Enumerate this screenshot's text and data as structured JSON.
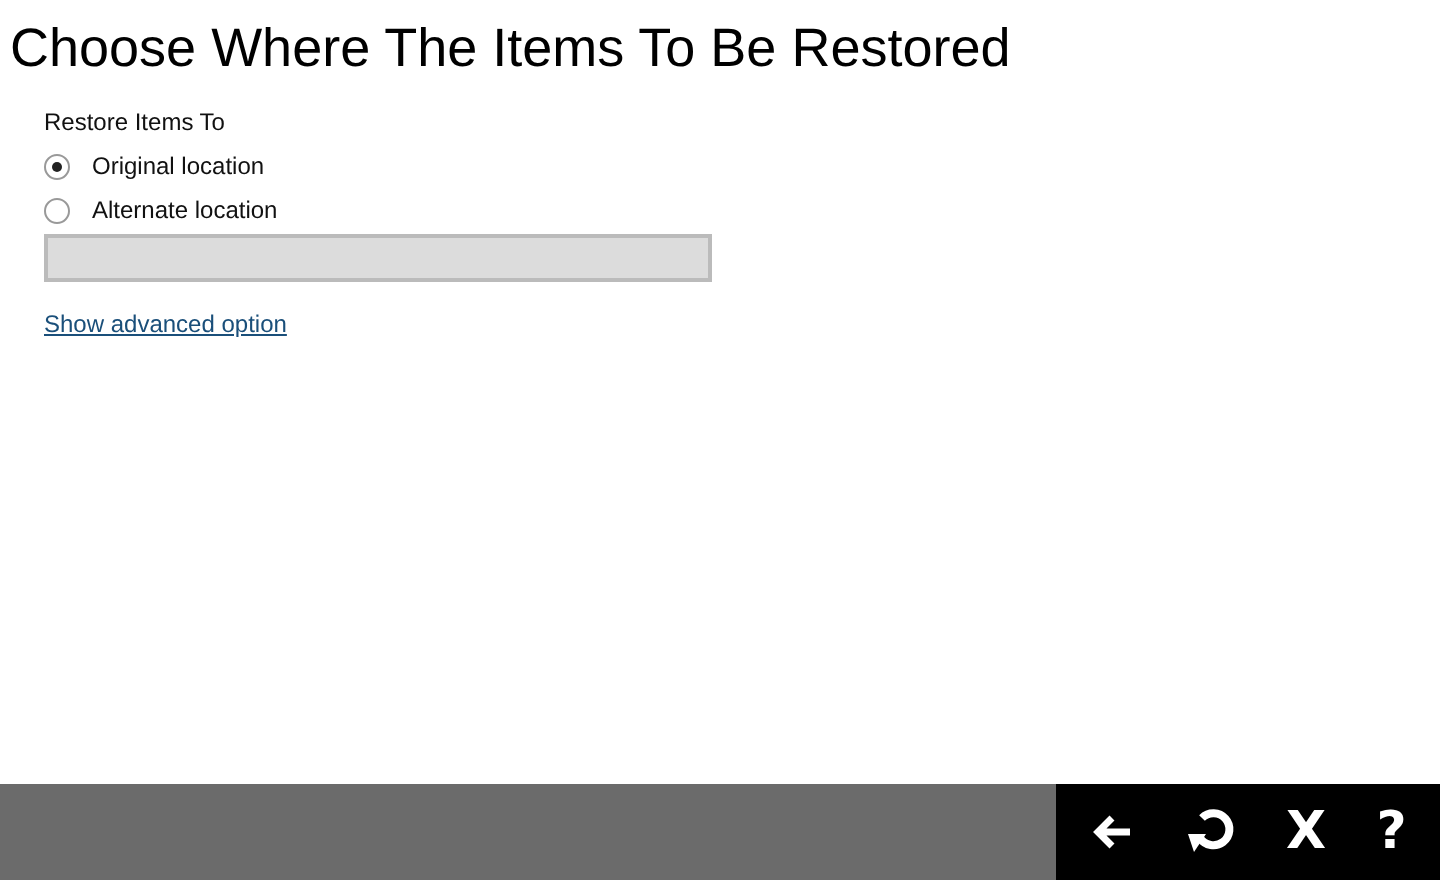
{
  "title": "Choose Where The Items To Be Restored",
  "group_label": "Restore Items To",
  "options": [
    {
      "label": "Original location",
      "selected": true
    },
    {
      "label": "Alternate location",
      "selected": false
    }
  ],
  "path_field": {
    "disabled": true
  },
  "advanced_link": "Show advanced option",
  "toolbar": [
    {
      "kind": "back"
    },
    {
      "kind": "undo"
    },
    {
      "kind": "text",
      "label": "X"
    },
    {
      "kind": "text",
      "label": "?"
    }
  ]
}
